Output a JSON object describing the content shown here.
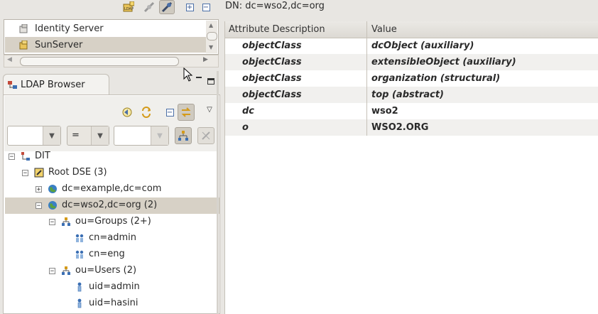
{
  "connections": {
    "items": [
      {
        "label": "Identity Server",
        "selected": false
      },
      {
        "label": "SunServer",
        "selected": true
      }
    ]
  },
  "browser": {
    "tab_title": "LDAP Browser",
    "filter_operator": "="
  },
  "tree": [
    {
      "label": "DIT",
      "level": 0,
      "expander": "−",
      "icon": "dit-icon",
      "selected": false
    },
    {
      "label": "Root DSE (3)",
      "level": 1,
      "expander": "−",
      "icon": "root-dse-icon",
      "selected": false
    },
    {
      "label": "dc=example,dc=com",
      "level": 2,
      "expander": "+",
      "icon": "globe-icon",
      "selected": false
    },
    {
      "label": "dc=wso2,dc=org (2)",
      "level": 2,
      "expander": "−",
      "icon": "globe-icon",
      "selected": true
    },
    {
      "label": "ou=Groups (2+)",
      "level": 3,
      "expander": "−",
      "icon": "org-unit-icon",
      "selected": false
    },
    {
      "label": "cn=admin",
      "level": 4,
      "expander": "",
      "icon": "group-icon",
      "selected": false
    },
    {
      "label": "cn=eng",
      "level": 4,
      "expander": "",
      "icon": "group-icon",
      "selected": false
    },
    {
      "label": "ou=Users (2)",
      "level": 3,
      "expander": "−",
      "icon": "org-unit-icon",
      "selected": false
    },
    {
      "label": "uid=admin",
      "level": 4,
      "expander": "",
      "icon": "person-icon",
      "selected": false
    },
    {
      "label": "uid=hasini",
      "level": 4,
      "expander": "",
      "icon": "person-icon",
      "selected": false
    }
  ],
  "entry": {
    "dn_text": "DN: dc=wso2,dc=org",
    "columns": [
      "Attribute Description",
      "Value"
    ],
    "rows": [
      {
        "attribute": "objectClass",
        "value": "dcObject (auxiliary)",
        "italic": true
      },
      {
        "attribute": "objectClass",
        "value": "extensibleObject (auxiliary)",
        "italic": true
      },
      {
        "attribute": "objectClass",
        "value": "organization (structural)",
        "italic": true
      },
      {
        "attribute": "objectClass",
        "value": "top (abstract)",
        "italic": true
      },
      {
        "attribute": "dc",
        "value": "wso2",
        "italic": false
      },
      {
        "attribute": "o",
        "value": "WSO2.ORG",
        "italic": false
      }
    ]
  },
  "colors": {
    "selection": "#d7d1c6",
    "panel_bg": "#e8e6e2",
    "icon_blue": "#4b6fa7"
  }
}
